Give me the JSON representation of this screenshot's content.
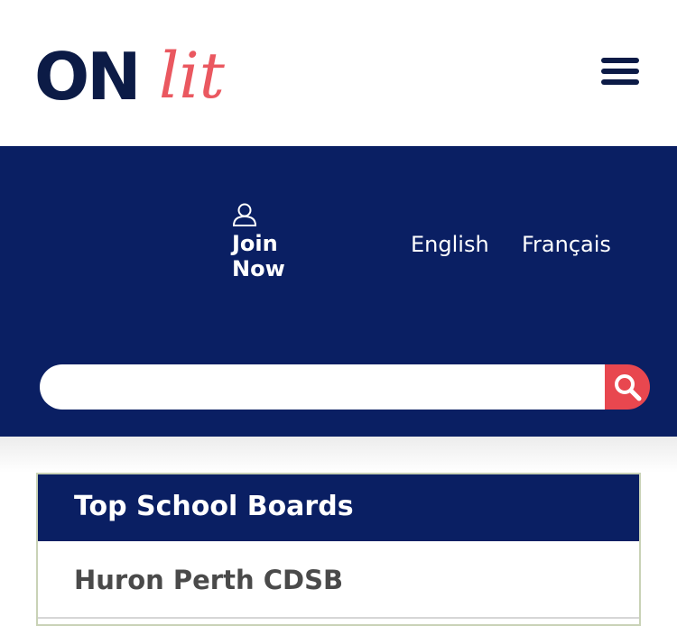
{
  "header": {
    "logo_text_primary": "ON",
    "logo_text_secondary": "lit",
    "menu_icon": "hamburger-menu-icon"
  },
  "band": {
    "join_icon": "user-icon",
    "join_label": "Join Now",
    "languages": [
      "English",
      "Français"
    ]
  },
  "search": {
    "placeholder": "",
    "button_icon": "search-icon"
  },
  "boards": {
    "title": "Top School Boards",
    "items": [
      "Huron Perth CDSB"
    ]
  },
  "colors": {
    "navy": "#0a1f63",
    "accent_red": "#e8474f",
    "logo_navy": "#0c1b46"
  }
}
